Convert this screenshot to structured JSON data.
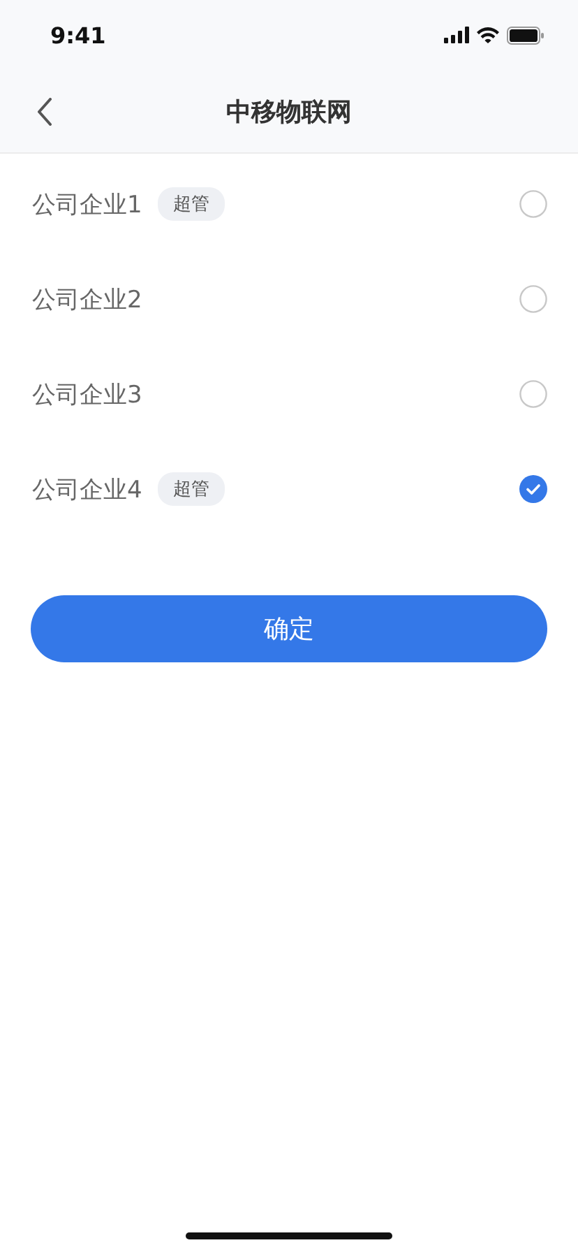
{
  "status_bar": {
    "time": "9:41"
  },
  "nav": {
    "title": "中移物联网"
  },
  "companies": [
    {
      "name": "公司企业1",
      "badge": "超管",
      "selected": false
    },
    {
      "name": "公司企业2",
      "selected": false
    },
    {
      "name": "公司企业3",
      "selected": false
    },
    {
      "name": "公司企业4",
      "badge": "超管",
      "selected": true
    }
  ],
  "confirm_button": "确定"
}
